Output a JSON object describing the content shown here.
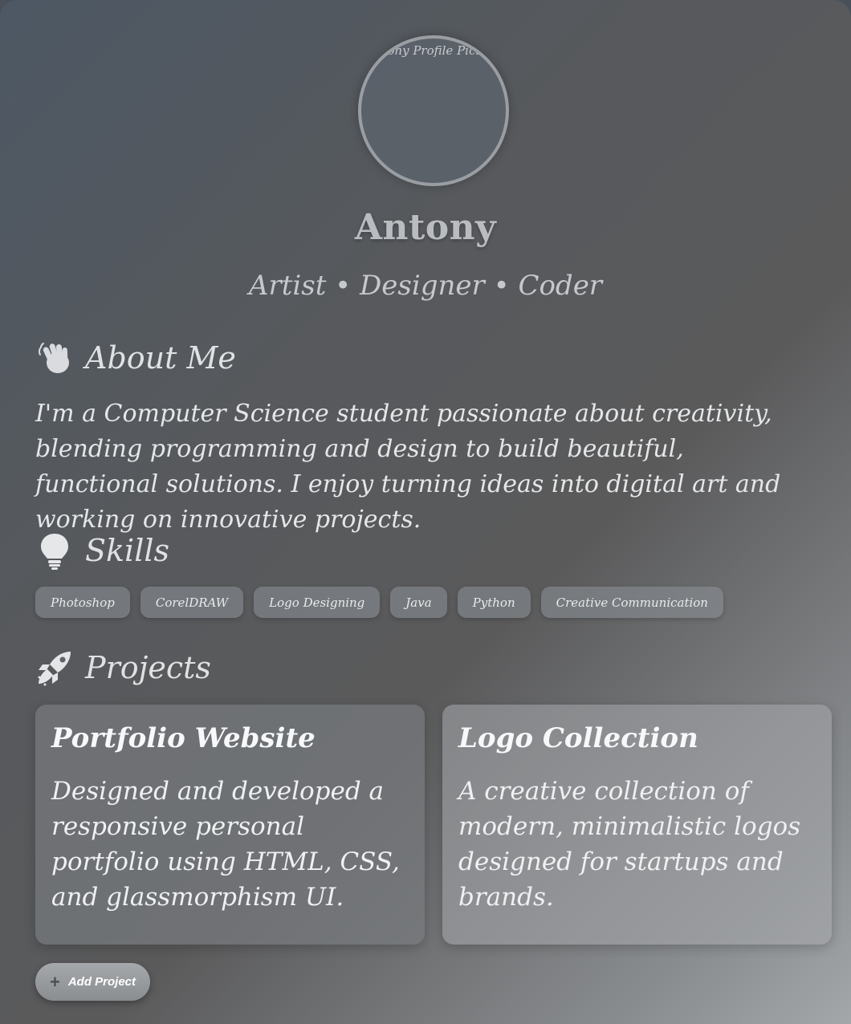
{
  "profile": {
    "avatar_alt": "Antony Profile Picture",
    "name": "Antony",
    "tagline": "Artist • Designer • Coder"
  },
  "about": {
    "icon": "waving-hand-icon",
    "title": "About Me",
    "text": "I'm a Computer Science student passionate about creativity, blending programming and design to build beautiful, functional solutions. I enjoy turning ideas into digital art and working on innovative projects."
  },
  "skills": {
    "icon": "light-bulb-icon",
    "title": "Skills",
    "items": [
      "Photoshop",
      "CorelDRAW",
      "Logo Designing",
      "Java",
      "Python",
      "Creative Communication"
    ]
  },
  "projects": {
    "icon": "rocket-icon",
    "title": "Projects",
    "items": [
      {
        "title": "Portfolio Website",
        "description": "Designed and developed a responsive personal portfolio using HTML, CSS, and glassmorphism UI."
      },
      {
        "title": "Logo Collection",
        "description": "A creative collection of modern, minimalistic logos designed for startups and brands."
      }
    ],
    "add_button": {
      "icon": "plus-icon",
      "label": "Add Project"
    }
  }
}
